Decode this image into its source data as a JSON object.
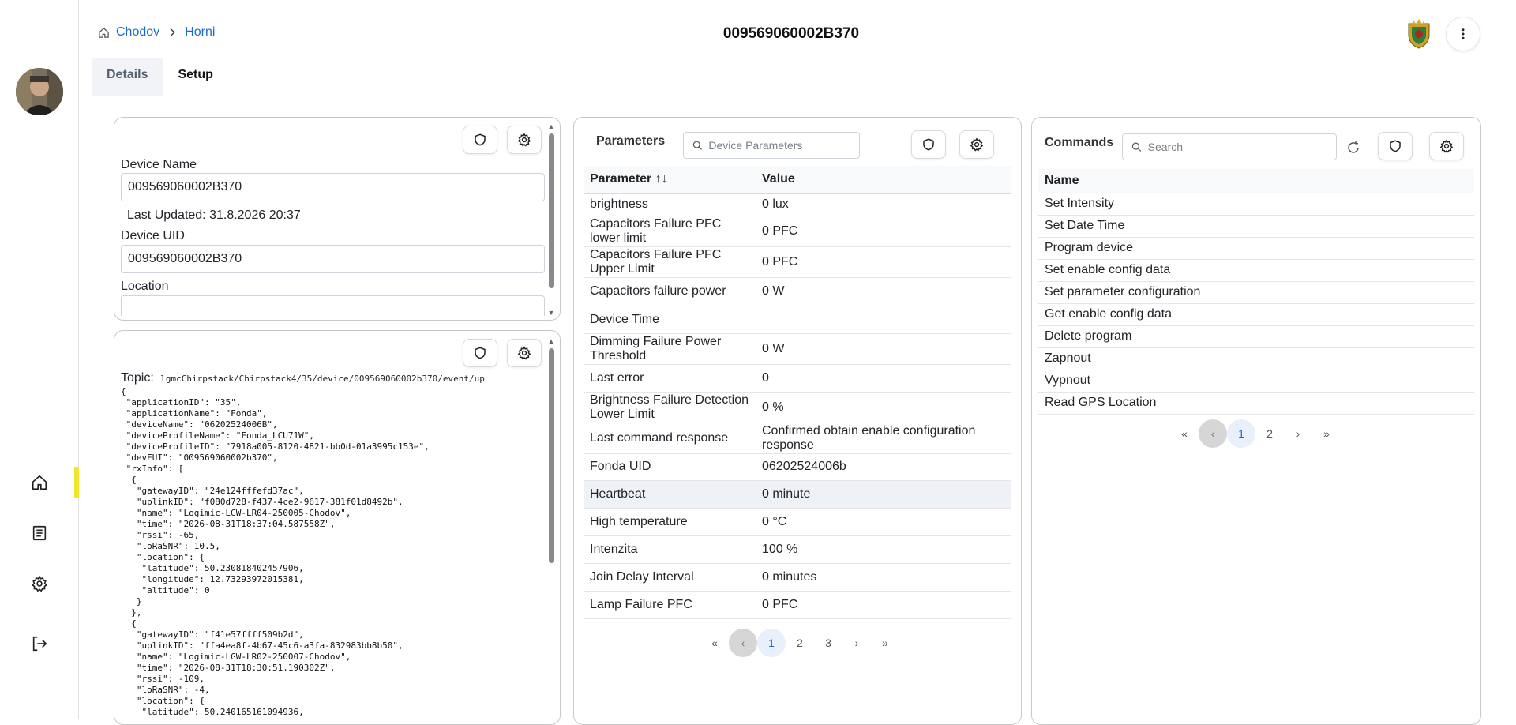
{
  "breadcrumb": {
    "items": [
      "Chodov",
      "Horni"
    ]
  },
  "page_title": "009569060002B370",
  "tabs": [
    {
      "label": "Details"
    },
    {
      "label": "Setup"
    }
  ],
  "device_panel": {
    "device_name_label": "Device Name",
    "device_name_value": "009569060002B370",
    "last_updated": "Last Updated: 31.8.2026 20:37",
    "device_uid_label": "Device UID",
    "device_uid_value": "009569060002B370",
    "location_label": "Location",
    "location_value": ""
  },
  "message_panel": {
    "topic_label": "Topic:",
    "topic_value": "lgmcChirpstack/Chirpstack4/35/device/009569060002b370/event/up",
    "json_lines": [
      "{",
      " \"applicationID\": \"35\",",
      " \"applicationName\": \"Fonda\",",
      " \"deviceName\": \"06202524006B\",",
      " \"deviceProfileName\": \"Fonda_LCU71W\",",
      " \"deviceProfileID\": \"7918a005-8120-4821-bb0d-01a3995c153e\",",
      " \"devEUI\": \"009569060002b370\",",
      " \"rxInfo\": [",
      "  {",
      "   \"gatewayID\": \"24e124fffefd37ac\",",
      "   \"uplinkID\": \"f080d728-f437-4ce2-9617-381f01d8492b\",",
      "   \"name\": \"Logimic-LGW-LR04-250005-Chodov\",",
      "   \"time\": \"2026-08-31T18:37:04.587558Z\",",
      "   \"rssi\": -65,",
      "   \"loRaSNR\": 10.5,",
      "   \"location\": {",
      "    \"latitude\": 50.230818402457906,",
      "    \"longitude\": 12.73293972015381,",
      "    \"altitude\": 0",
      "   }",
      "  },",
      "  {",
      "   \"gatewayID\": \"f41e57ffff509b2d\",",
      "   \"uplinkID\": \"ffa4ea8f-4b67-45c6-a3fa-832983bb8b50\",",
      "   \"name\": \"Logimic-LGW-LR02-250007-Chodov\",",
      "   \"time\": \"2026-08-31T18:30:51.190302Z\",",
      "   \"rssi\": -109,",
      "   \"loRaSNR\": -4,",
      "   \"location\": {",
      "    \"latitude\": 50.240165161094936,"
    ]
  },
  "parameters": {
    "title": "Parameters",
    "search_placeholder": "Device Parameters",
    "col_parameter": "Parameter",
    "col_value": "Value",
    "sort_glyph": "↑↓",
    "rows": [
      {
        "name": "brightness",
        "value": "0 lux"
      },
      {
        "name": "Capacitors Failure PFC lower limit",
        "value": "0 PFC"
      },
      {
        "name": "Capacitors Failure PFC Upper Limit",
        "value": "0 PFC"
      },
      {
        "name": "Capacitors failure power",
        "value": "0 W"
      },
      {
        "name": "Device Time",
        "value": ""
      },
      {
        "name": "Dimming Failure Power Threshold",
        "value": "0 W"
      },
      {
        "name": "Last error",
        "value": "0"
      },
      {
        "name": "Brightness Failure Detection Lower Limit",
        "value": "0 %"
      },
      {
        "name": "Last command response",
        "value": "Confirmed obtain enable configuration response"
      },
      {
        "name": "Fonda UID",
        "value": "06202524006b"
      },
      {
        "name": "Heartbeat",
        "value": "0 minute"
      },
      {
        "name": "High temperature",
        "value": "0 °C"
      },
      {
        "name": "Intenzita",
        "value": "100 %"
      },
      {
        "name": "Join Delay Interval",
        "value": "0 minutes"
      },
      {
        "name": "Lamp Failure PFC",
        "value": "0 PFC"
      }
    ],
    "highlighted_row": 10,
    "pager": [
      "1",
      "2",
      "3"
    ],
    "current_page": "1"
  },
  "commands": {
    "title": "Commands",
    "search_placeholder": "Search",
    "col_name": "Name",
    "rows": [
      "Set Intensity",
      "Set Date Time",
      "Program device",
      "Set enable config data",
      "Set parameter configuration",
      "Get enable config data",
      "Delete program",
      "Zapnout",
      "Vypnout",
      "Read GPS Location"
    ],
    "pager": [
      "1",
      "2"
    ],
    "current_page": "1"
  },
  "icons": {
    "home": "home-icon",
    "log": "document-icon",
    "settings": "gear-icon",
    "logout": "logout-icon",
    "shield": "shield-icon",
    "more": "more-vertical-icon",
    "refresh": "refresh-icon",
    "search": "search-icon"
  },
  "colors": {
    "link": "#1a6bd6",
    "active_nav": "#f5e42a",
    "highlight_row": "#eef2f7"
  }
}
